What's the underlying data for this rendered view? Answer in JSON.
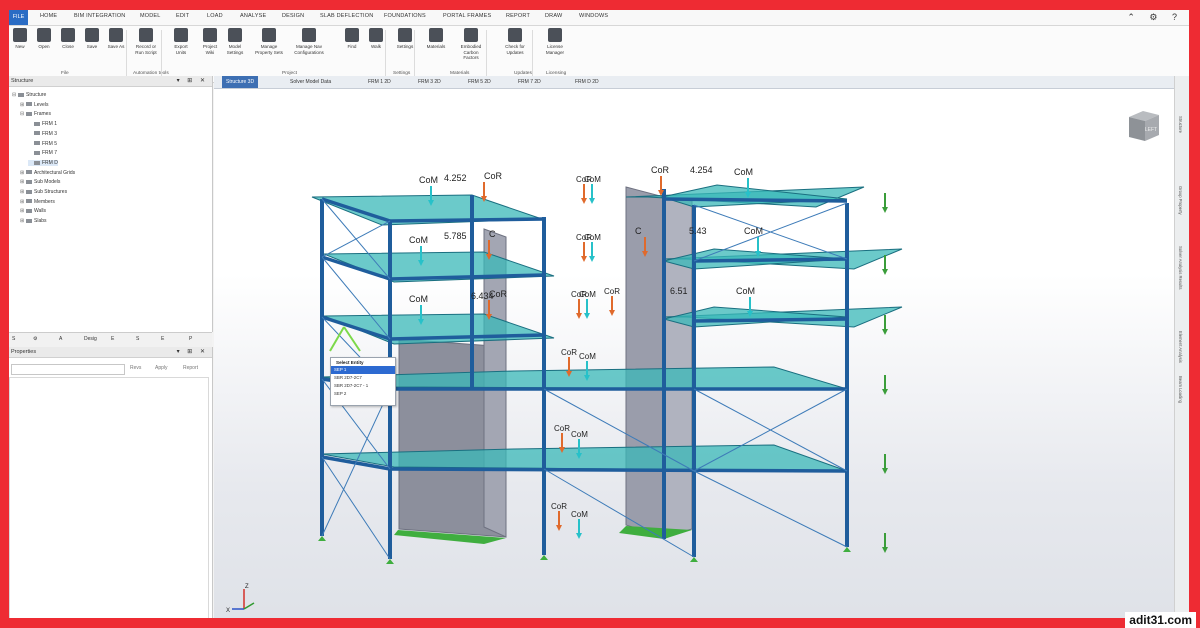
{
  "colors": {
    "frame": "#ee2b33",
    "active_tab": "#3d6fb3",
    "steel": "#1f5d9c",
    "slab": "#39b8b8",
    "core": "#8c8f9c",
    "cor_arrow": "#e06a2c",
    "com_arrow": "#27c1c9",
    "load_arrow": "#3a9d3a",
    "support": "#3fae3f"
  },
  "menu": {
    "file": "FILE",
    "tabs": [
      "HOME",
      "BIM INTEGRATION",
      "MODEL",
      "EDIT",
      "LOAD",
      "ANALYSE",
      "DESIGN",
      "SLAB DEFLECTION",
      "FOUNDATIONS",
      "PORTAL FRAMES",
      "REPORT",
      "DRAW",
      "WINDOWS"
    ],
    "window_controls": "⌃ ⚙ ?"
  },
  "ribbon": {
    "buttons": [
      {
        "label": "New",
        "icon": "new-icon"
      },
      {
        "label": "Open",
        "icon": "open-folder-icon"
      },
      {
        "label": "Close",
        "icon": "close-file-icon"
      },
      {
        "label": "Save",
        "icon": "save-icon"
      },
      {
        "label": "Save As",
        "icon": "save-as-icon"
      },
      {
        "label": "Record or\nRun Script",
        "icon": "script-icon"
      },
      {
        "label": "Export\nUnits",
        "icon": "export-units-icon"
      },
      {
        "label": "Project\nWiki",
        "icon": "wiki-icon"
      },
      {
        "label": "Model\nSettings",
        "icon": "model-settings-icon"
      },
      {
        "label": "Manage\nProperty Sets",
        "icon": "property-sets-icon"
      },
      {
        "label": "Manage Nav\nConfigurations",
        "icon": "configurations-icon"
      },
      {
        "label": "Find",
        "icon": "find-icon"
      },
      {
        "label": "Walk",
        "icon": "walk-icon"
      },
      {
        "label": "Settings",
        "icon": "settings-icon"
      },
      {
        "label": "Materials",
        "icon": "materials-icon"
      },
      {
        "label": "Embodied\nCarbon Factors",
        "icon": "carbon-icon"
      },
      {
        "label": "Check for\nUpdates",
        "icon": "updates-icon"
      },
      {
        "label": "License\nManager",
        "icon": "license-icon"
      }
    ],
    "groups": [
      "File",
      "Automation tools",
      "Project",
      "Settings",
      "Materials",
      "Updates",
      "Licensing"
    ]
  },
  "tree": {
    "title": "Structure",
    "controls": "▾ ⊞ ✕",
    "nodes": [
      {
        "label": "Structure",
        "level": 0,
        "toggle": "⊟"
      },
      {
        "label": "Levels",
        "level": 1,
        "toggle": "⊞"
      },
      {
        "label": "Frames",
        "level": 1,
        "toggle": "⊟"
      },
      {
        "label": "FRM 1",
        "level": 2,
        "toggle": ""
      },
      {
        "label": "FRM 3",
        "level": 2,
        "toggle": ""
      },
      {
        "label": "FRM 5",
        "level": 2,
        "toggle": ""
      },
      {
        "label": "FRM 7",
        "level": 2,
        "toggle": ""
      },
      {
        "label": "FRM D",
        "level": 2,
        "toggle": "",
        "selected": true
      },
      {
        "label": "Architectural Grids",
        "level": 1,
        "toggle": "⊞"
      },
      {
        "label": "Sub Models",
        "level": 1,
        "toggle": "⊞"
      },
      {
        "label": "Sub Structures",
        "level": 1,
        "toggle": "⊞"
      },
      {
        "label": "Members",
        "level": 1,
        "toggle": "⊞"
      },
      {
        "label": "Walls",
        "level": 1,
        "toggle": "⊞"
      },
      {
        "label": "Slabs",
        "level": 1,
        "toggle": "⊞"
      }
    ]
  },
  "panel_tabs": [
    "S",
    "⚙",
    "A",
    "Desig",
    "E",
    "S",
    "E",
    "P"
  ],
  "properties": {
    "title": "Properties",
    "controls": "▾ ⊞ ✕",
    "buttons": [
      "Revs",
      "Apply",
      "Report"
    ]
  },
  "doc_tabs": [
    "Structure 3D",
    "Solver Model Data",
    "FRM 1 2D",
    "FRM 3 2D",
    "FRM 5 2D",
    "FRM 7 2D",
    "FRM D 2D"
  ],
  "select_menu": {
    "header": "Select Entity",
    "items": [
      "SEP 1",
      "SBR 2D7-2C7",
      "SBR 2D7-2C7 - 1",
      "SEP 2"
    ],
    "selected_index": 0
  },
  "viewcube": {
    "label": "LEFT"
  },
  "axes": {
    "z": "Z",
    "x": "X"
  },
  "annotations": {
    "tower1": [
      {
        "com": "CoM",
        "value": "4.252",
        "cor": "CoR"
      },
      {
        "com": "CoM",
        "value": "5.785",
        "cor": "C"
      },
      {
        "com": "CoM",
        "value": "6.434",
        "cor": "CoR"
      }
    ],
    "tower2": [
      {
        "cor": "CoR",
        "value": "4.254",
        "com": "CoM"
      },
      {
        "cor": "C",
        "value": "5.43",
        "com": "CoM"
      },
      {
        "cor": "",
        "value": "6.51",
        "com": "CoM"
      }
    ],
    "middle": [
      {
        "text": "CoR"
      },
      {
        "text": "CoM"
      },
      {
        "text": "CoR"
      },
      {
        "text": "CoM"
      },
      {
        "text": "CoR"
      },
      {
        "text": "CoM"
      },
      {
        "text": "CoR"
      },
      {
        "text": "CoR"
      },
      {
        "text": "CoM"
      },
      {
        "text": "CoR"
      },
      {
        "text": "CoM"
      },
      {
        "text": "CoR"
      },
      {
        "text": "CoM"
      }
    ]
  },
  "right_dock": [
    "Structure",
    "Group Property",
    "Solver Analysis Results",
    "Element Analysis",
    "Beam Loading"
  ],
  "watermark": "adit31.com"
}
